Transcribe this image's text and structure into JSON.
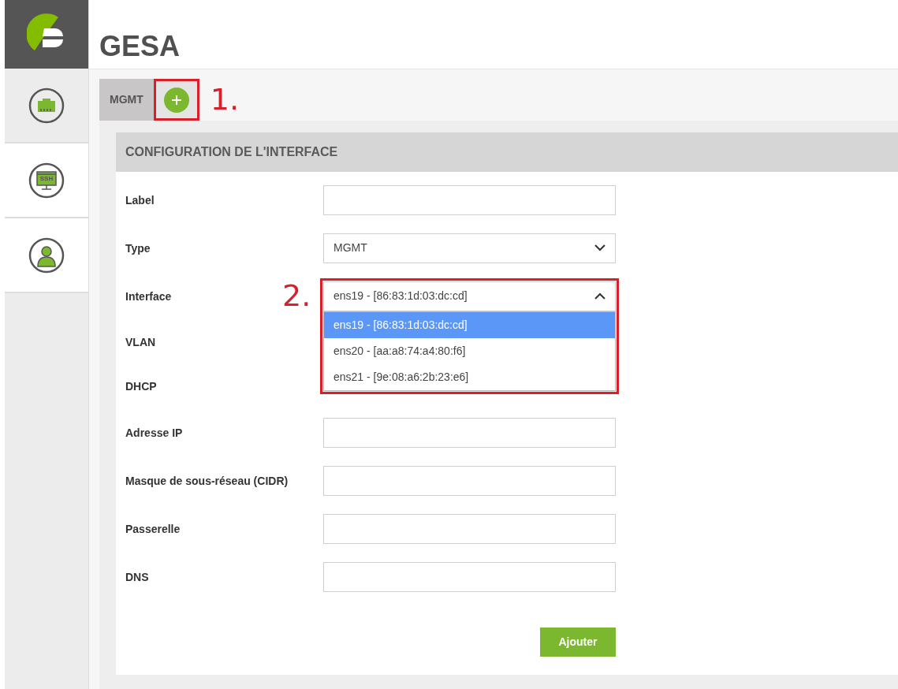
{
  "sidebar": {
    "items": [
      {
        "kind": "network",
        "selected": true
      },
      {
        "kind": "ssh",
        "label": "SSH",
        "selected": false
      },
      {
        "kind": "user",
        "selected": false
      }
    ]
  },
  "title": "GESA",
  "tabs": [
    {
      "label": "MGMT",
      "selected": true
    }
  ],
  "annotations": [
    {
      "text": "1."
    },
    {
      "text": "2."
    }
  ],
  "panel": {
    "title": "CONFIGURATION DE L'INTERFACE",
    "fields": [
      {
        "kind": "text",
        "label": "Label"
      },
      {
        "kind": "select",
        "label": "Type",
        "value": "MGMT"
      },
      {
        "kind": "dropdown",
        "label": "Interface",
        "value": "ens19 - [86:83:1d:03:dc:cd]",
        "options": [
          {
            "label": "ens19 - [86:83:1d:03:dc:cd]",
            "selected": true
          },
          {
            "label": "ens20 - [aa:a8:74:a4:80:f6]",
            "selected": false
          },
          {
            "label": "ens21 - [9e:08:a6:2b:23:e6]",
            "selected": false
          }
        ]
      },
      {
        "kind": "covered",
        "label": "VLAN"
      },
      {
        "kind": "covered",
        "label": "DHCP"
      },
      {
        "kind": "text",
        "label": "Adresse IP"
      },
      {
        "kind": "text",
        "label": "Masque de sous-réseau (CIDR)"
      },
      {
        "kind": "text",
        "label": "Passerelle"
      },
      {
        "kind": "text",
        "label": "DNS"
      }
    ],
    "submit": "Ajouter"
  }
}
